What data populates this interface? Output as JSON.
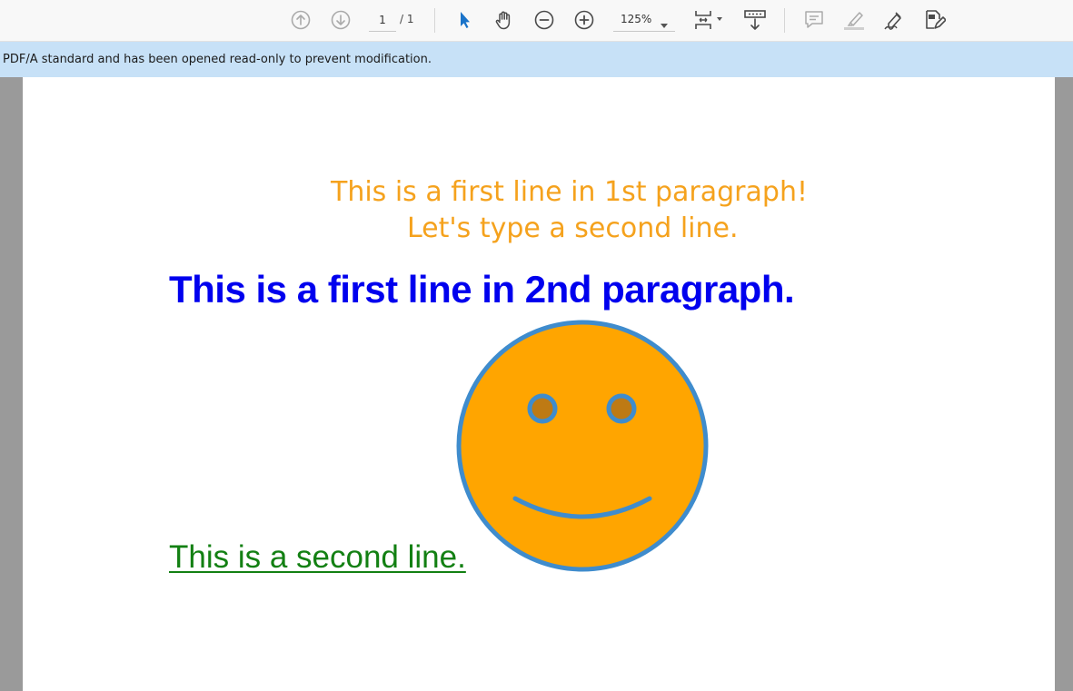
{
  "toolbar": {
    "page_current": "1",
    "page_total": "/ 1",
    "zoom": "125%",
    "icons": [
      "arrow-up-circle-icon",
      "arrow-down-circle-icon",
      "select-cursor-icon",
      "hand-icon",
      "zoom-out-icon",
      "zoom-in-icon",
      "zoom-caret-icon",
      "page-fit-icon",
      "scroll-mode-icon",
      "comment-icon",
      "highlight-icon",
      "sign-icon",
      "edit-pdf-icon"
    ]
  },
  "banner": {
    "text": "PDF/A standard and has been opened read-only to prevent modification."
  },
  "document": {
    "para1_line1": "This is a first line in 1st paragraph!",
    "para1_line2": "Let's type a second line.",
    "para2_line1": "This is a first line in 2nd paragraph.",
    "para2_line2": "This is a second line."
  },
  "colors": {
    "para1": "#f5a21d",
    "para2_line1": "#0000ee",
    "para2_line2": "#138013",
    "smiley_face": "#ffa500",
    "smiley_outline": "#3f8ccd",
    "smiley_eyes": "#be7a14",
    "banner": "#c7e1f7"
  }
}
